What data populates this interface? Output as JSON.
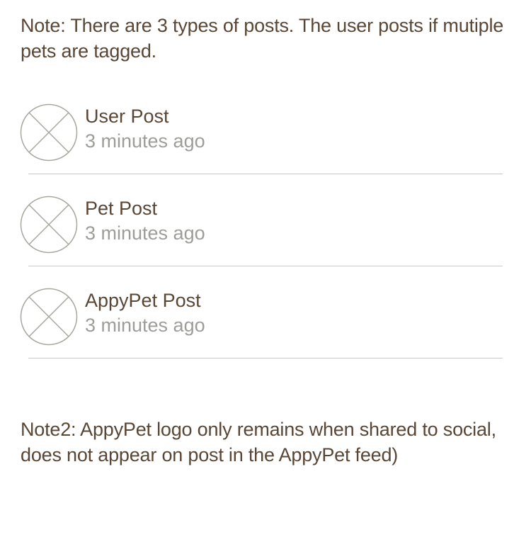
{
  "notes": {
    "note1": "Note: There are 3 types of posts. The user posts if mutiple pets are tagged.",
    "note2": "Note2: AppyPet logo only remains when shared to social, does not appear on post in the AppyPet feed)"
  },
  "posts": [
    {
      "title": "User Post",
      "time": "3 minutes ago",
      "avatar_icon": "image-placeholder-icon"
    },
    {
      "title": "Pet Post",
      "time": "3 minutes ago",
      "avatar_icon": "image-placeholder-icon"
    },
    {
      "title": "AppyPet Post",
      "time": "3 minutes ago",
      "avatar_icon": "image-placeholder-icon"
    }
  ],
  "colors": {
    "text": "#5a4634",
    "muted": "#9d9d9a",
    "divider": "#c9c9c2",
    "placeholder": "#a7a79f"
  }
}
